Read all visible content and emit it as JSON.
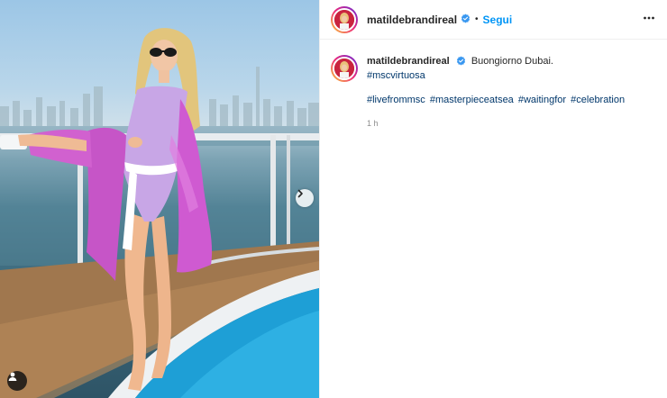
{
  "post": {
    "username": "matildebrandireal",
    "follow_label": "Segui",
    "separator": "•",
    "caption_text": "Buongiorno Dubai.",
    "caption_hashtag": "#mscvirtuosa",
    "hashtags": [
      "#livefrommsc",
      "#masterpieceatsea",
      "#waitingfor",
      "#celebration"
    ],
    "time_ago": "1 h"
  },
  "colors": {
    "follow_blue": "#0095f6",
    "hashtag_blue": "#00376b",
    "verified_blue": "#3897f0",
    "divider": "#efefef",
    "muted_text": "#8e8e8e"
  },
  "icons": {
    "verified": "verified-badge-icon",
    "more": "more-options-icon",
    "next": "chevron-right-icon",
    "user_tags": "user-tag-icon"
  }
}
